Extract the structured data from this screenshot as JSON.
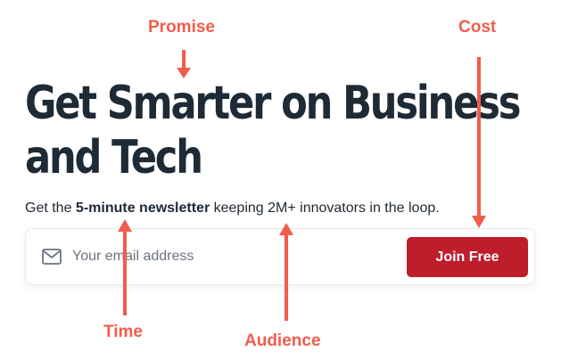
{
  "headline": {
    "line1": "Get Smarter on Business",
    "line2": "and Tech"
  },
  "subline": {
    "prefix": "Get the ",
    "emphasis": "5-minute newsletter",
    "suffix": " keeping 2M+ innovators in the loop."
  },
  "signup": {
    "email_placeholder": "Your email address",
    "email_value": "",
    "button_label": "Join Free",
    "icon": "mail-icon"
  },
  "annotations": {
    "promise": "Promise",
    "cost": "Cost",
    "time": "Time",
    "audience": "Audience"
  },
  "colors": {
    "headline": "#1e2a35",
    "button": "#be1d2c",
    "annotation": "#f25c4c"
  }
}
